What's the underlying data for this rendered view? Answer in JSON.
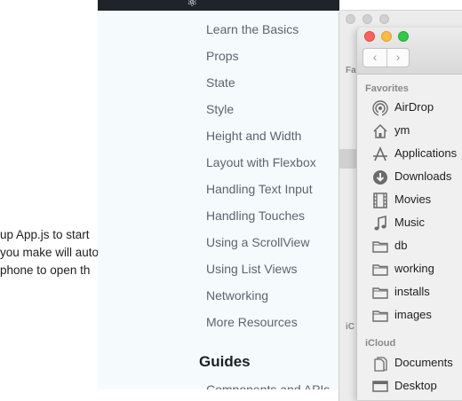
{
  "background_text": {
    "lines": [
      "up App.js to start",
      "you make will auto",
      "phone to open th"
    ]
  },
  "docs": {
    "logo_icon": "react-logo-icon",
    "items": [
      "Learn the Basics",
      "Props",
      "State",
      "Style",
      "Height and Width",
      "Layout with Flexbox",
      "Handling Text Input",
      "Handling Touches",
      "Using a ScrollView",
      "Using List Views",
      "Networking",
      "More Resources"
    ],
    "guides_heading": "Guides",
    "cut_item": "Components and APIs"
  },
  "finder_back": {
    "favorites_label": "Fa",
    "icloud_label": "iC"
  },
  "finder_front": {
    "favorites_label": "Favorites",
    "favorites": [
      {
        "label": "AirDrop",
        "icon": "airdrop-icon"
      },
      {
        "label": "ym",
        "icon": "home-icon"
      },
      {
        "label": "Applications",
        "icon": "applications-icon"
      },
      {
        "label": "Downloads",
        "icon": "downloads-icon"
      },
      {
        "label": "Movies",
        "icon": "movies-icon"
      },
      {
        "label": "Music",
        "icon": "music-icon"
      },
      {
        "label": "db",
        "icon": "folder-icon"
      },
      {
        "label": "working",
        "icon": "folder-icon"
      },
      {
        "label": "installs",
        "icon": "folder-icon"
      },
      {
        "label": "images",
        "icon": "folder-icon"
      }
    ],
    "icloud_label": "iCloud",
    "icloud": [
      {
        "label": "Documents",
        "icon": "documents-icon"
      },
      {
        "label": "Desktop",
        "icon": "desktop-icon"
      }
    ]
  }
}
